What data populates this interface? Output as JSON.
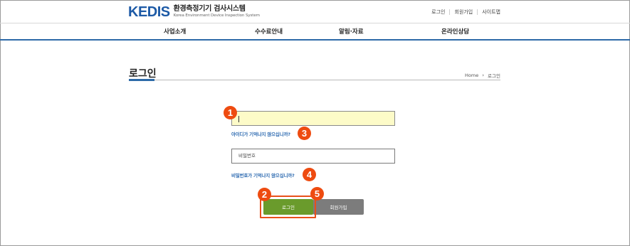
{
  "header": {
    "logo_word": "KEDIS",
    "logo_title": "환경측정기기 검사시스템",
    "logo_subtitle": "Korea Environment Device Inspection System",
    "util_links": [
      "로그인",
      "회원가입",
      "사이트맵"
    ]
  },
  "nav": {
    "items": [
      "사업소개",
      "수수료안내",
      "알림·자료",
      "온라인상담"
    ]
  },
  "page": {
    "title": "로그인",
    "breadcrumb": [
      "Home",
      "로그인"
    ]
  },
  "form": {
    "id_value": "",
    "password_placeholder": "비밀번호",
    "forgot_id_link": "아이디가 기억나지 않으십니까?",
    "forgot_pw_link": "비밀번호가 기억나지 않으십니까?",
    "login_button": "로그인",
    "join_button": "회원가입"
  },
  "callouts": [
    "1",
    "2",
    "3",
    "4",
    "5"
  ],
  "colors": {
    "brand_blue": "#1d5aa6",
    "login_green": "#6a9b2c",
    "join_gray": "#7c7c7c",
    "callout_orange": "#ee4b10",
    "id_field_highlight": "#fdfbc8"
  }
}
